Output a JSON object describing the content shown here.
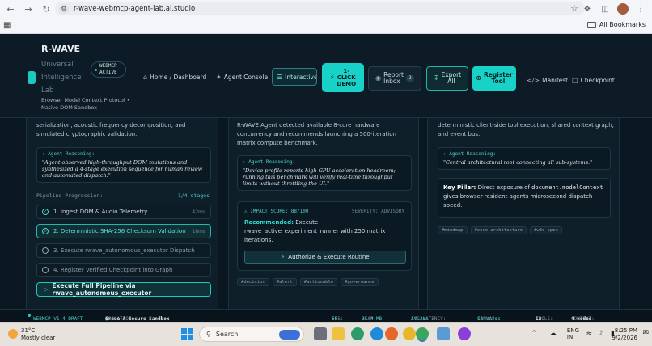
{
  "browser": {
    "url": "r-wave-webmcp-agent-lab.ai.studio",
    "bookmarks_label": "All Bookmarks"
  },
  "header": {
    "brand": "R-WAVE",
    "sub_lines": [
      "Universal",
      "Intelligence",
      "Lab"
    ],
    "description": "Browser Model Context Protocol • Native DOM Sandbox",
    "badge_line1": "WEBMCP",
    "badge_line2": "ACTIVE",
    "nav": {
      "home": "Home / Dashboard",
      "agent_console": "Agent Console",
      "interactive": "Interactive",
      "one_click_l1": "1-",
      "one_click_l2": "CLICK",
      "one_click_l3": "DEMO",
      "report_l1": "Report",
      "report_l2": "Inbox",
      "report_count": "2",
      "export_l1": "Export",
      "export_l2": "All",
      "register_l1": "Register",
      "register_l2": "Tool",
      "manifest": "Manifest",
      "checkpoint": "Checkpoint"
    }
  },
  "left_card": {
    "intro": "serialization, acoustic frequency decomposition, and simulated cryptographic validation.",
    "reasoning_label": "Agent Reasoning:",
    "reasoning_text": "\"Agent observed high-throughput DOM mutations and synthesized a 4-stage execution sequence for human review and automated dispatch.\"",
    "pipeline_title": "Pipeline Progression:",
    "pipeline_count": "1/4 stages",
    "steps": [
      {
        "num": "1",
        "label": "1. Ingest DOM & Audio Telemetry",
        "time": "42ms"
      },
      {
        "num": "2",
        "label": "2. Deterministic SHA-256 Checksum Validation",
        "time": "18ms"
      },
      {
        "num": "3",
        "label": "3. Execute rwave_autonomous_executor Dispatch",
        "time": ""
      },
      {
        "num": "4",
        "label": "4. Register Verified Checkpoint into Graph",
        "time": ""
      }
    ],
    "run_button": "Execute Full Pipeline via rwave_autonomous_executor"
  },
  "mid_card": {
    "intro": "R-WAVE Agent detected available 8-core hardware concurrency and recommends launching a 500-iteration matrix compute benchmark.",
    "reasoning_label": "Agent Reasoning:",
    "reasoning_text": "\"Device profile reports high GPU acceleration headroom; running this benchmark will verify real-time throughput limits without throttling the UI.\"",
    "impact_score": "IMPACT SCORE: 88/100",
    "severity": "SEVERITY: ADVISORY",
    "rec_label": "Recommended:",
    "rec_text": " Execute rwave_active_experiment_runner with 250 matrix iterations.",
    "auth_button": "Authorize & Execute Routine",
    "tags": [
      "#decision",
      "#alert",
      "#actionable",
      "#governance"
    ]
  },
  "right_card": {
    "intro": "deterministic client-side tool execution, shared context graph, and event bus.",
    "reasoning_label": "Agent Reasoning:",
    "reasoning_text": "\"Central architectural root connecting all sub-systems.\"",
    "pillar_label": "Key Pillar:",
    "pillar_text_a": " Direct exposure of ",
    "pillar_code": "document.modelContext",
    "pillar_text_b": " gives browser-resident agents microsecond dispatch speed.",
    "tags": [
      "#mindmap",
      "#core-architecture",
      "#w3c-spec"
    ]
  },
  "status": {
    "version": "WEBMCP V1.4-DRAFT",
    "isolation_label": "ISOLATION:",
    "isolation_value": "Grade-A Secure Sandbox",
    "fps_label": "FPS:",
    "fps": "60",
    "heap_label": "HEAP:",
    "heap": "21.4 MB",
    "latency_label": "AVG LATENCY:",
    "latency": "14.2ms",
    "canvas_label": "CANVAS:",
    "canvas": "13 cards",
    "tools_label": "TOOLS:",
    "tools": "12",
    "context_label": "CONTEXT:",
    "context": "4 nodes"
  },
  "taskbar": {
    "temp": "31°C",
    "weather": "Mostly clear",
    "search": "Search",
    "lang1": "ENG",
    "lang2": "IN",
    "time": "8:25 PM",
    "date": "9/2/2026"
  }
}
